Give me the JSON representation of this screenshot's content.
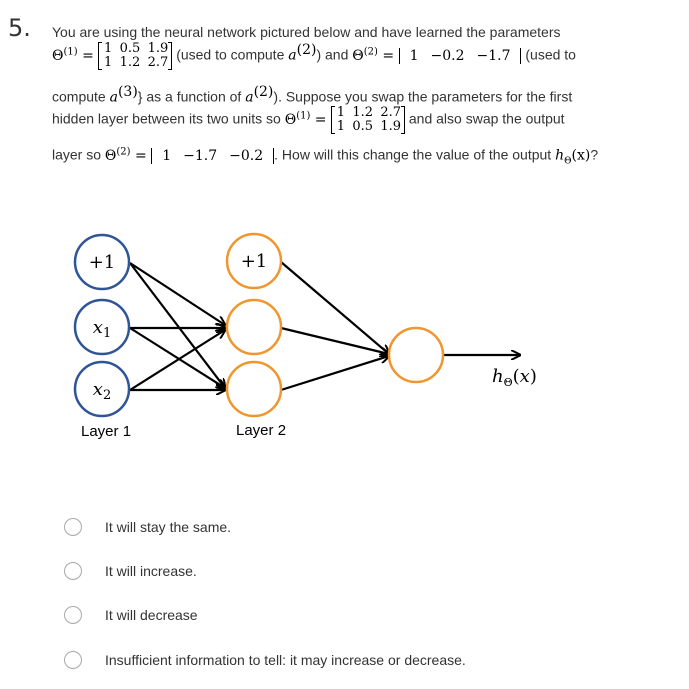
{
  "question": {
    "number": "5.",
    "line1": "You are using the neural network pictured below and have learned the parameters",
    "theta1_label": "Θ",
    "theta1_sup": "(1)",
    "theta1_matrix": [
      [
        "1",
        "0.5",
        "1.9"
      ],
      [
        "1",
        "1.2",
        "2.7"
      ]
    ],
    "used_a2": "(used to compute ",
    "a_var": "a",
    "sup2": "(2)",
    "and_text": ") and ",
    "theta2_sup": "(2)",
    "theta2_vector": [
      "1",
      "−0.2",
      "−1.7"
    ],
    "used_to": "(used to",
    "line3_a": "compute ",
    "sup3": "(3)",
    "line3_b": "} as a function of ",
    "line3_c": "). Suppose you swap the parameters for the first",
    "line4_a": "hidden layer between its two units so ",
    "theta1_swapped_matrix": [
      [
        "1",
        "1.2",
        "2.7"
      ],
      [
        "1",
        "0.5",
        "1.9"
      ]
    ],
    "line4_b": "and also swap the output",
    "line5_a": "layer so ",
    "theta2_swapped_vector": [
      "1",
      "−1.7",
      "−0.2"
    ],
    "line5_b": ". How will this change the value of the output ",
    "h_theta_x": "h",
    "h_sub": "Θ",
    "h_arg": "(x)",
    "qmark": "?"
  },
  "diagram": {
    "layer1_nodes": [
      "+1",
      "x1",
      "x2"
    ],
    "layer2_nodes": [
      "+1",
      "",
      ""
    ],
    "output_label": "hΘ(x)",
    "layer1_label": "Layer 1",
    "layer2_label": "Layer 2",
    "colors": {
      "layer1": "#2f5597",
      "layer2": "#f0962e",
      "edges": "#000000"
    }
  },
  "options": [
    {
      "label": "It will stay the same."
    },
    {
      "label": "It will increase."
    },
    {
      "label": "It will decrease"
    },
    {
      "label": "Insufficient information to tell: it may increase or decrease."
    }
  ]
}
